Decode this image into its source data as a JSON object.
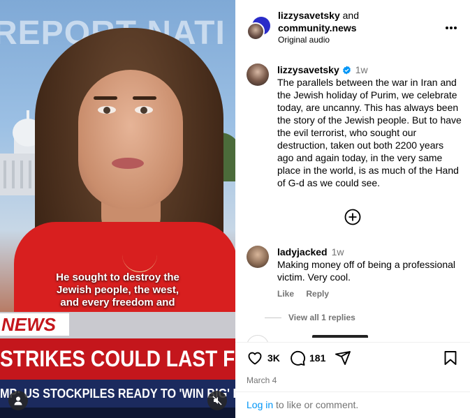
{
  "video": {
    "background_banner": "REPORT NATI",
    "caption_lines": [
      "He sought to destroy the",
      "Jewish people, the west,",
      "and every freedom and"
    ],
    "chyron_label": "NEWS",
    "chyron_headline": "STRIKES COULD LAST FO",
    "chyron_subline": "MP: US STOCKPILES READY TO 'WIN BIG' D"
  },
  "header": {
    "author": "lizzysavetsky",
    "joiner": " and",
    "coauthor": "community.news",
    "audio": "Original audio"
  },
  "post": {
    "username": "lizzysavetsky",
    "time": "1w",
    "caption": "The parallels between the war in Iran and the Jewish holiday of Purim, we celebrate today, are uncanny. This has always been the story of the Jewish people. But to have the evil terrorist, who sought our destruction, taken out both 2200 years ago and again today, in the very same place in the world, is as much of the Hand of G-d as we could see."
  },
  "comments": [
    {
      "username": "ladyjacked",
      "time": "1w",
      "text": "Making money off of being a professional victim. Very cool.",
      "like_label": "Like",
      "reply_label": "Reply",
      "view_replies": "View all 1 replies"
    }
  ],
  "actions": {
    "likes": "3K",
    "comments": "181",
    "date": "March 4"
  },
  "footer": {
    "login_link": "Log in",
    "login_rest": " to like or comment."
  },
  "colors": {
    "link": "#0095f6",
    "muted": "#737373",
    "verified": "#0095f6",
    "chyron_red": "#c4161c",
    "chyron_blue": "#1b2a5e"
  },
  "icons": [
    "more-options-icon",
    "verified-badge-icon",
    "add-circle-icon",
    "heart-icon",
    "comment-icon",
    "share-icon",
    "bookmark-icon",
    "user-tag-icon",
    "muted-audio-icon"
  ]
}
